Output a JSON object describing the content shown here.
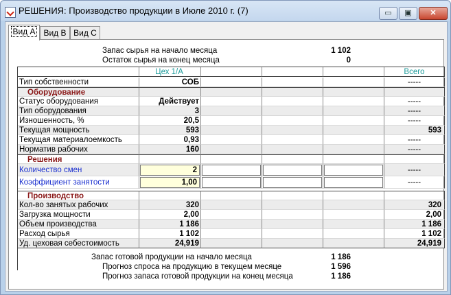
{
  "window": {
    "title": "РЕШЕНИЯ: Производство продукции в Июле 2010 г. (7)",
    "min_glyph": "▭",
    "max_glyph": "▣",
    "close_glyph": "✕"
  },
  "tabs": [
    {
      "label": "Вид А",
      "active": true
    },
    {
      "label": "Вид В",
      "active": false
    },
    {
      "label": "Вид С",
      "active": false
    }
  ],
  "top_summary": [
    {
      "label": "Запас сырья на начало месяца",
      "value": "1 102"
    },
    {
      "label": "Остаток сырья на конец месяца",
      "value": "0"
    }
  ],
  "columns": {
    "unit": "Цех 1/А",
    "total": "Всего"
  },
  "rows": {
    "ownership": {
      "label": "Тип собственности",
      "value": "СОБ",
      "total": "-----"
    },
    "equipment_section": "Оборудование",
    "equipment_status": {
      "label": "Статус оборудования",
      "value": "Действует",
      "total": "-----"
    },
    "equipment_type": {
      "label": "Тип оборудования",
      "value": "3",
      "total": "-----"
    },
    "wear": {
      "label": "Изношенность, %",
      "value": "20,5",
      "total": "-----"
    },
    "capacity": {
      "label": "Текущая мощность",
      "value": "593",
      "total": "593"
    },
    "material_intensity": {
      "label": "Текущая материалоемкость",
      "value": "0,93",
      "total": "-----"
    },
    "workers_norm": {
      "label": "Норматив рабочих",
      "value": "160",
      "total": "-----"
    },
    "decisions_section": "Решения",
    "shifts": {
      "label": "Количество смен",
      "value": "2",
      "total": "-----"
    },
    "load_factor": {
      "label": "Коэффициент занятости",
      "value": "1,00",
      "total": "-----"
    },
    "production_section": "Производство",
    "workers_employed": {
      "label": "Кол-во занятых рабочих",
      "value": "320",
      "total": "320"
    },
    "capacity_load": {
      "label": "Загрузка мощности",
      "value": "2,00",
      "total": "2,00"
    },
    "output": {
      "label": "Объем производства",
      "value": "1 186",
      "total": "1 186"
    },
    "material_use": {
      "label": "Расход сырья",
      "value": "1 102",
      "total": "1 102"
    },
    "unit_cost": {
      "label": "Уд. цеховая себестоимость",
      "value": "24,919",
      "total": "24,919"
    }
  },
  "bottom_summary": [
    {
      "label": "Запас готовой продукции на начало месяца",
      "value": "1 186"
    },
    {
      "label": "Прогноз спроса на продукцию в текущем месяце",
      "value": "1 596"
    },
    {
      "label": "Прогноз запаса готовой продукции на конец месяца",
      "value": "1 186"
    }
  ]
}
